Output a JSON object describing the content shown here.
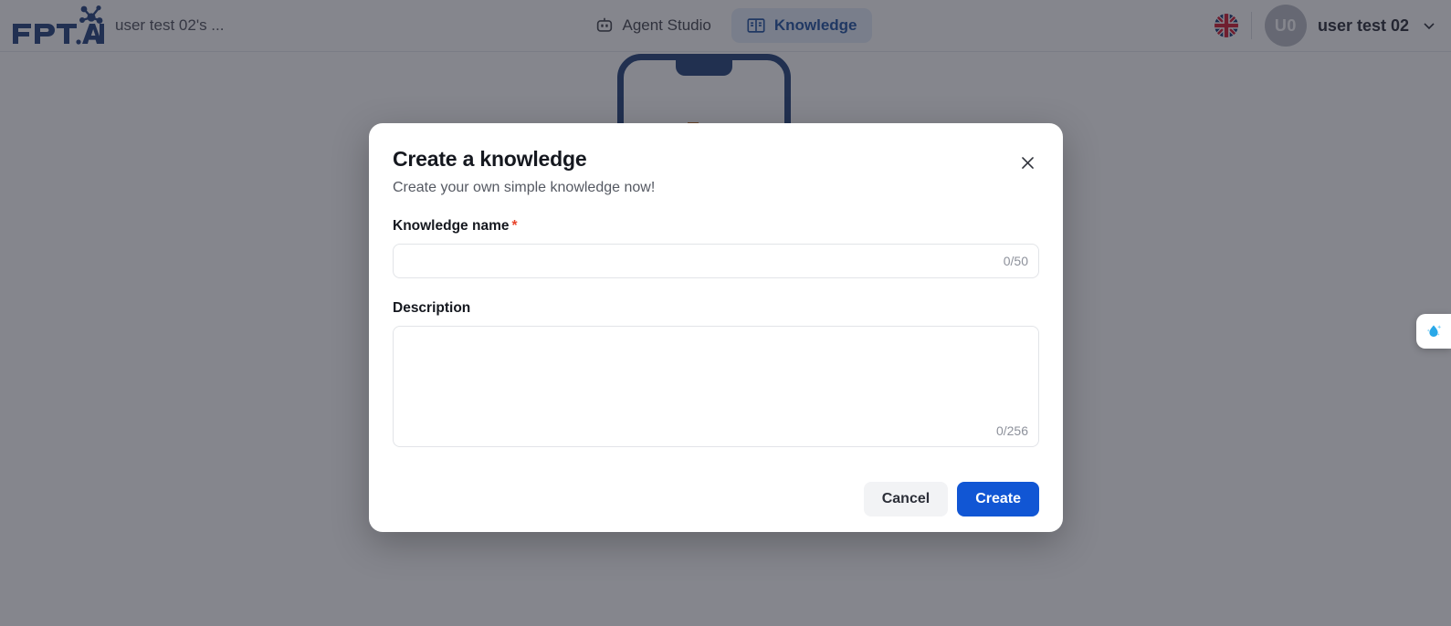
{
  "header": {
    "brand_subtitle": "user test 02's ...",
    "logo_alt": "fpt-ai-logo",
    "nav": [
      {
        "label": "Agent Studio",
        "icon": "robot-icon",
        "active": false
      },
      {
        "label": "Knowledge",
        "icon": "book-icon",
        "active": true
      }
    ],
    "language_icon": "uk-flag-icon",
    "user": {
      "initials": "U0",
      "name": "user test 02",
      "chevron_icon": "chevron-down-icon"
    }
  },
  "side_tab": {
    "icon": "water-drop-sparkle-icon"
  },
  "modal": {
    "title": "Create a knowledge",
    "subtitle": "Create your own simple knowledge now!",
    "close_icon": "close-icon",
    "fields": {
      "name": {
        "label": "Knowledge name",
        "required_mark": "*",
        "value": "",
        "placeholder": "",
        "counter": "0/50"
      },
      "description": {
        "label": "Description",
        "value": "",
        "placeholder": "",
        "counter": "0/256"
      }
    },
    "buttons": {
      "cancel": "Cancel",
      "create": "Create"
    }
  },
  "colors": {
    "primary": "#1156d4",
    "accent_nav": "#1a4fa0",
    "required": "#e8452c",
    "overlay": "#252833"
  }
}
